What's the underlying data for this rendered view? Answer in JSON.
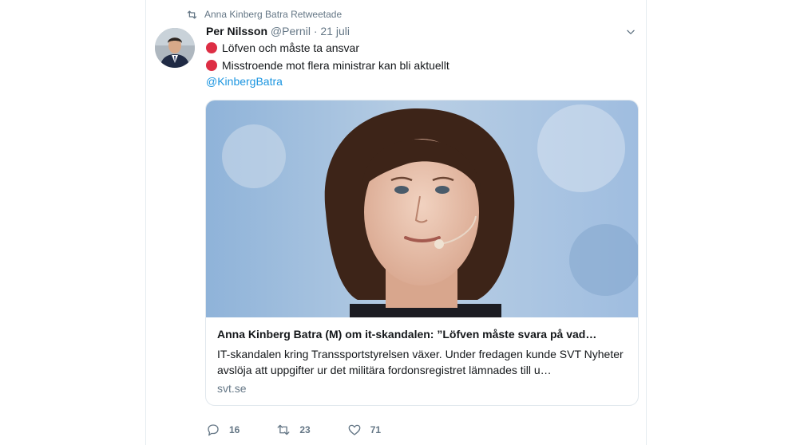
{
  "retweet": {
    "label": "Anna Kinberg Batra Retweetade",
    "icon": "retweet-icon"
  },
  "tweet": {
    "author_name": "Per Nilsson",
    "author_handle": "@Pernil",
    "separator": "·",
    "date": "21 juli",
    "lines": [
      {
        "icon": "red-stop-sign-emoji",
        "text": "Löfven och måste ta ansvar"
      },
      {
        "icon": "red-stop-sign-emoji",
        "text": "Misstroende mot flera ministrar kan bli aktuellt"
      }
    ],
    "mention": "@KinbergBatra"
  },
  "card": {
    "title": "Anna Kinberg Batra (M) om it-skandalen: ”Löfven måste svara på vad…",
    "description": "IT-skandalen kring Transsportstyrelsen växer. Under fredagen kunde SVT Nyheter avslöja att uppgifter ur det militära fordonsregistret lämnades till u…",
    "domain": "svt.se"
  },
  "actions": {
    "reply_count": "16",
    "retweet_count": "23",
    "like_count": "71"
  },
  "colors": {
    "link": "#1b95e0",
    "muted": "#657786",
    "stop_red": "#dd2e44"
  }
}
